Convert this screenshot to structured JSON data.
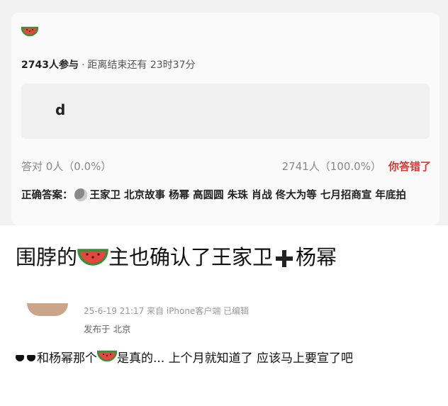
{
  "poll": {
    "top_icon": "watermelon-icon",
    "participants": "2743人参与",
    "separator": "·",
    "time_left": "距离结束还有 23时37分",
    "option": "d",
    "correct_stat": "答对  0人（0.0%）",
    "wrong_stat": "2741人（100.0%）",
    "wrong_label": "你答错了",
    "answer_label": "正确答案：",
    "answer_text": "王家卫 北京故事 杨幂 高圆圆 朱珠 肖战 佟大为等 七月招商宣 年底拍"
  },
  "headline": {
    "part1": "围脖的",
    "part2": "主也确认了王家卫",
    "part3": "杨幂"
  },
  "comment": {
    "meta_line": "25-6-19 21:17  来自 iPhone客户端  已编辑",
    "location": "发布于 北京",
    "text1": "和杨幂那个",
    "text2": "是真的... 上个月就知道了 应该马上要宣了吧"
  },
  "colors": {
    "wrong": "#e0342f",
    "watermelon_rind": "#3a8f3a",
    "watermelon_flesh": "#e8453c"
  }
}
